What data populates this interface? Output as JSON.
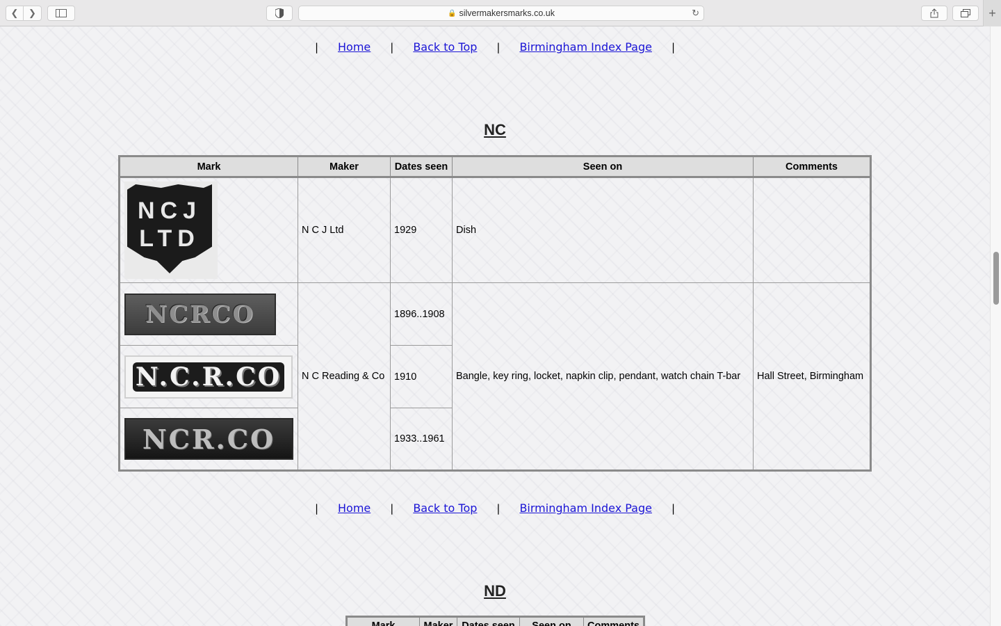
{
  "browser": {
    "url": "silvermakersmarks.co.uk",
    "reload_icon": "reload-icon",
    "new_tab": "+"
  },
  "nav": {
    "home": "Home",
    "back_to_top": "Back to Top",
    "index": "Birmingham Index Page",
    "sep": "|"
  },
  "section_nc": {
    "heading": "NC",
    "columns": [
      "Mark",
      "Maker",
      "Dates seen",
      "Seen on",
      "Comments"
    ],
    "rows": [
      {
        "mark_text": "NCJ LTD",
        "maker": "N C J Ltd",
        "dates": "1929",
        "seen_on": "Dish",
        "comments": ""
      },
      {
        "mark_text": "NCRCO",
        "maker": "N C Reading & Co",
        "dates": "1896..1908",
        "seen_on": "Bangle, key ring, locket, napkin clip, pendant, watch chain T-bar",
        "comments": "Hall Street, Birmingham"
      },
      {
        "mark_text": "N.C.R.CO",
        "dates": "1910"
      },
      {
        "mark_text": "NCR.CO",
        "dates": "1933..1961"
      }
    ]
  },
  "section_nd": {
    "heading": "ND",
    "columns": [
      "Mark",
      "Maker",
      "Dates seen",
      "Seen on",
      "Comments"
    ]
  }
}
